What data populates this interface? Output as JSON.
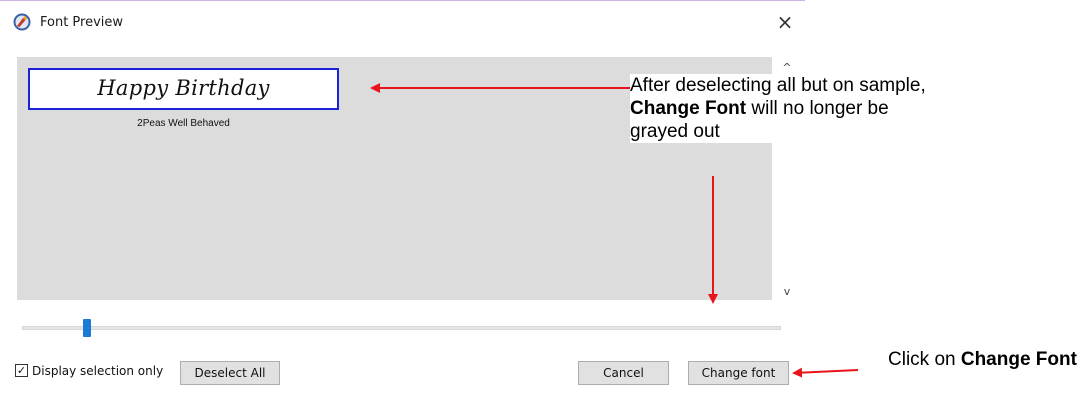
{
  "window": {
    "title": "Font Preview",
    "close_glyph": "×",
    "icon": "font-preview-icon"
  },
  "preview": {
    "sample_text": "Happy Birthday",
    "font_name": "2Peas Well Behaved",
    "scroll_up_glyph": "^",
    "scroll_down_glyph": "v"
  },
  "slider": {
    "value": 0.09
  },
  "footer": {
    "checkbox_label": "Display selection only",
    "checkbox_checked": true,
    "checkbox_glyph": "✓",
    "deselect_label": "Deselect All",
    "cancel_label": "Cancel",
    "change_font_label": "Change font"
  },
  "annotations": {
    "top_note_part1": "After deselecting all but on sample, ",
    "top_note_bold": "Change Font",
    "top_note_part2": " will no longer be grayed out",
    "bottom_note_part1": "Click on ",
    "bottom_note_bold": "Change Font",
    "arrow_color": "#e8141c"
  },
  "colors": {
    "selection_border": "#1c22d6",
    "slider_thumb": "#1a7ad4",
    "panel_bg": "#dcdcdc"
  }
}
